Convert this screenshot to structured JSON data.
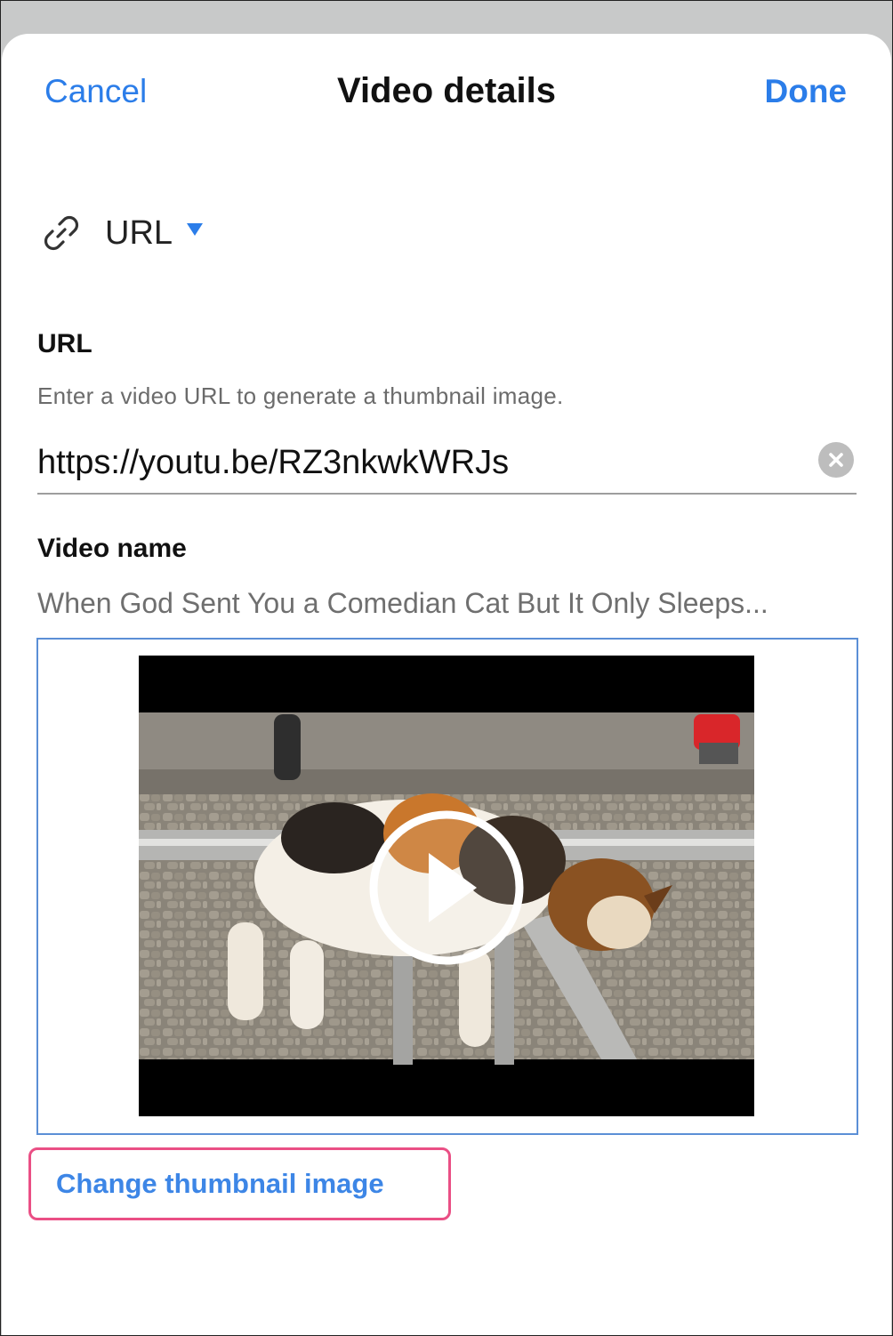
{
  "header": {
    "cancel_label": "Cancel",
    "title": "Video details",
    "done_label": "Done"
  },
  "source": {
    "icon": "link-icon",
    "label": "URL",
    "dropdown_icon": "triangle-down-icon"
  },
  "url_field": {
    "label": "URL",
    "help_text": "Enter a video URL to generate a thumbnail image.",
    "value": "https://youtu.be/RZ3nkwkWRJs",
    "clear_icon": "clear-circle-icon"
  },
  "video_name": {
    "label": "Video name",
    "value": "When God Sent You a Comedian Cat But It Only Sleeps..."
  },
  "thumbnail": {
    "description_icon": "play-icon"
  },
  "actions": {
    "change_thumbnail_label": "Change thumbnail image"
  },
  "colors": {
    "accent": "#2b7de9",
    "highlight_border": "#ea4f85",
    "thumbnail_border": "#5b8fd6"
  }
}
